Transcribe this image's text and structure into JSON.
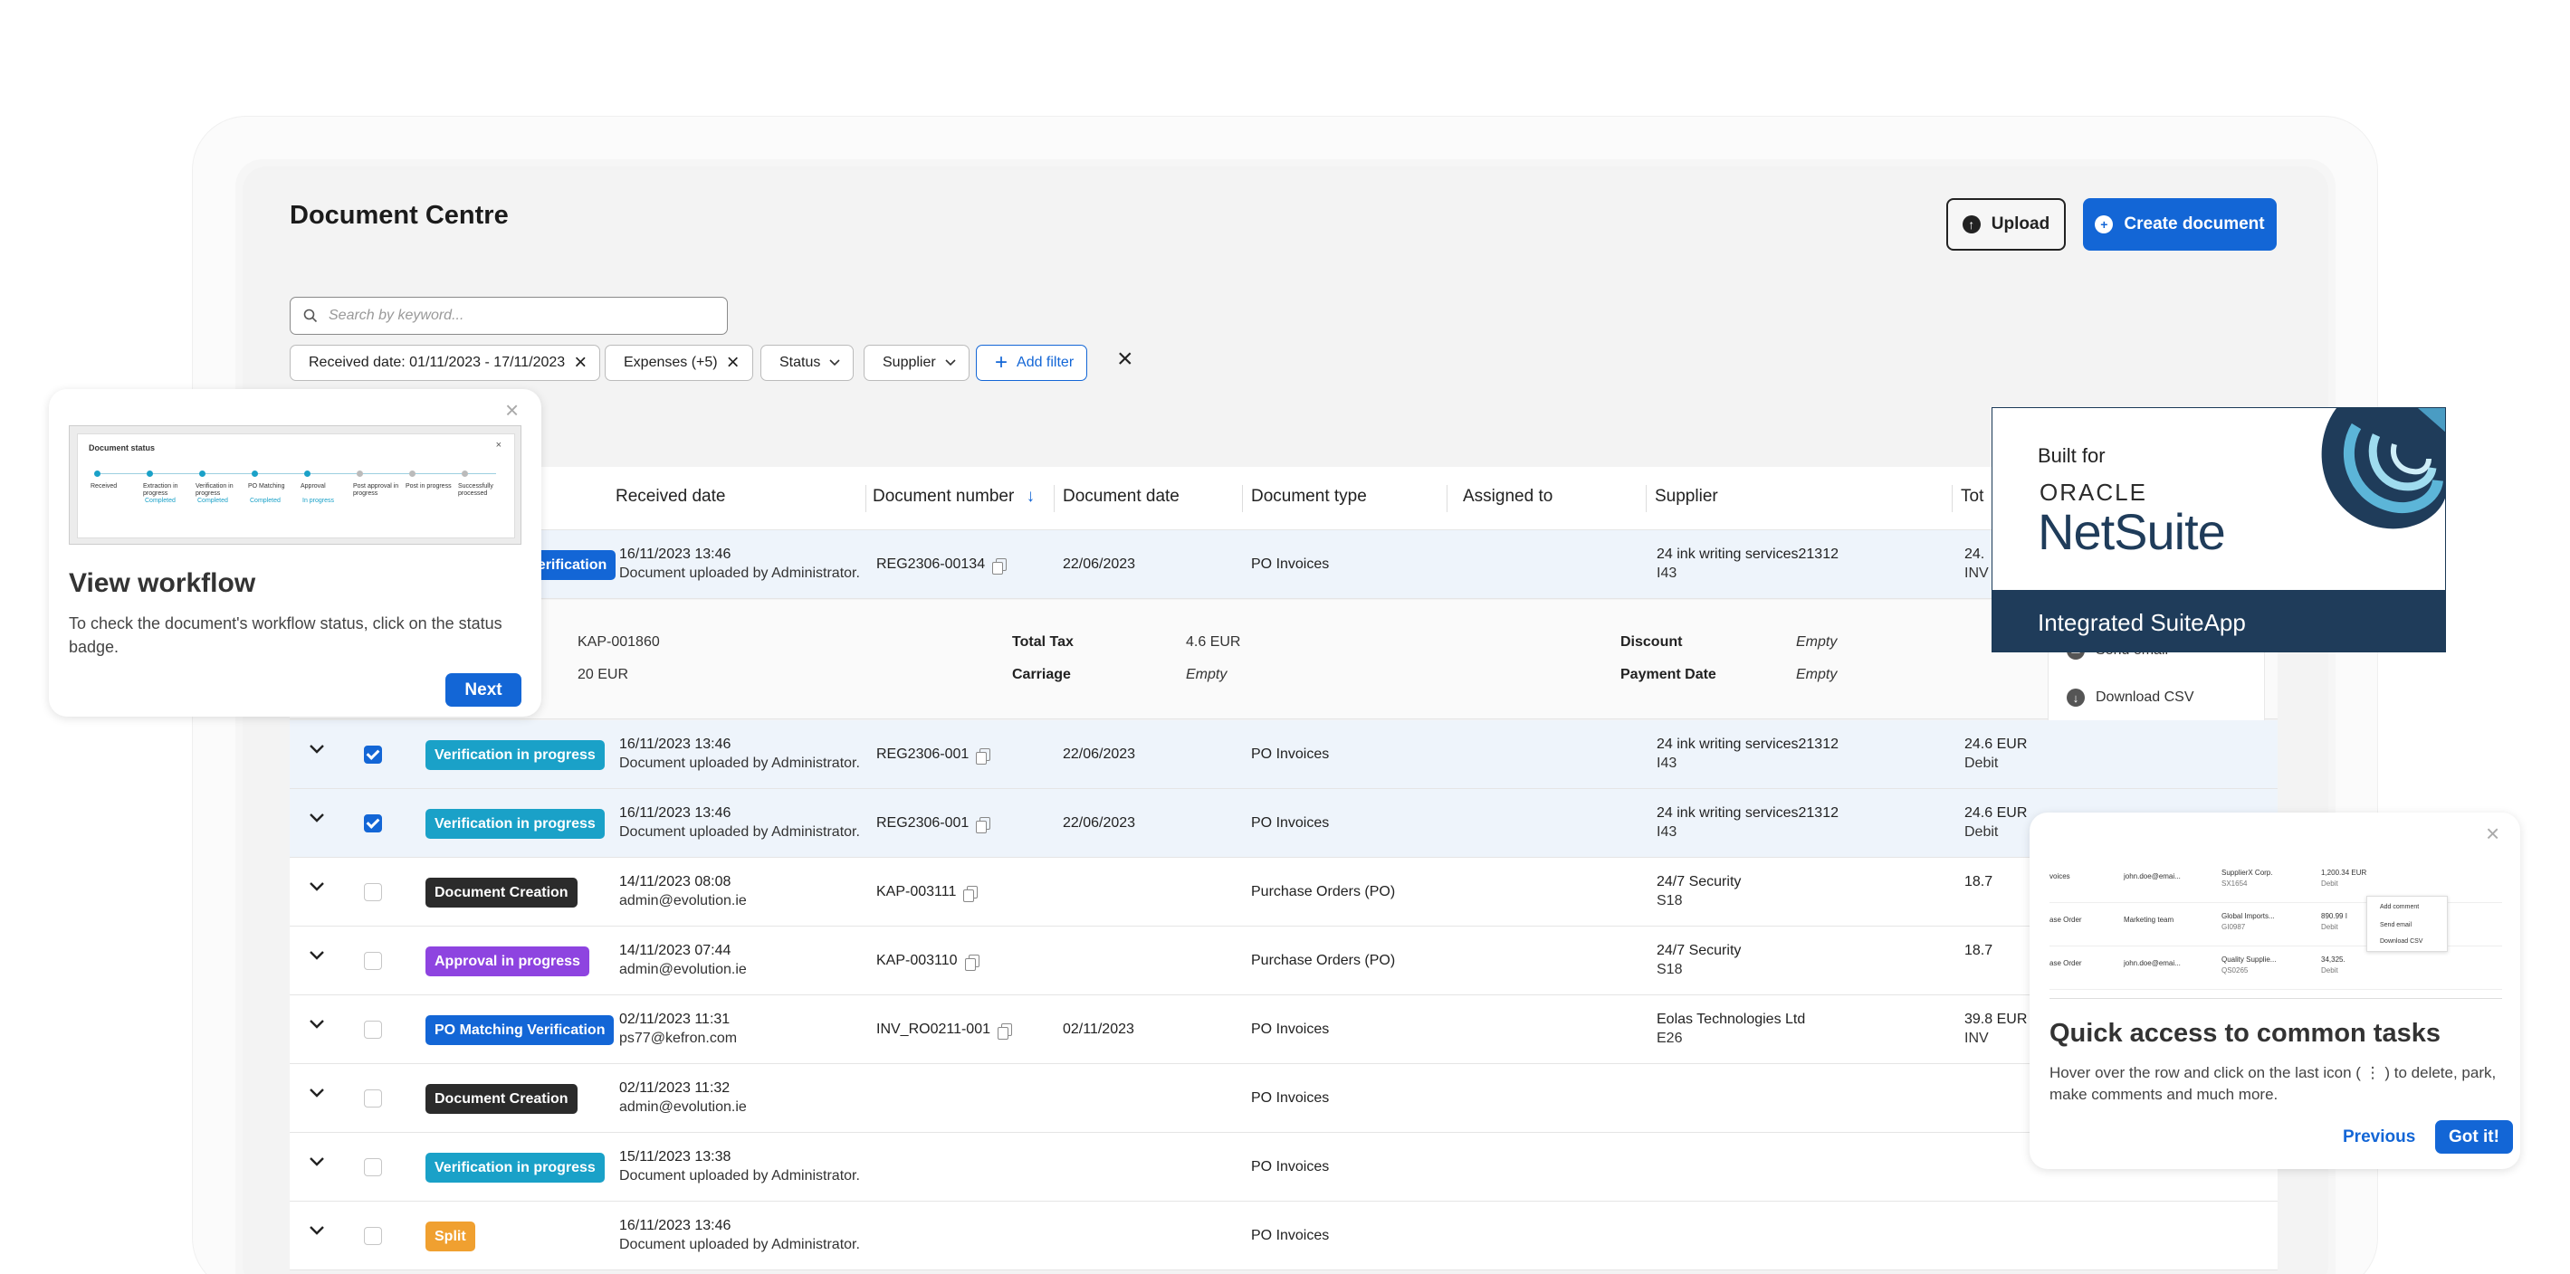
{
  "page": {
    "title": "Document Centre",
    "upload_label": "Upload",
    "create_label": "Create document"
  },
  "search": {
    "placeholder": "Search by keyword..."
  },
  "filters": {
    "received_date": "Received date: 01/11/2023 - 17/11/2023",
    "expenses": "Expenses (+5)",
    "status": "Status",
    "supplier": "Supplier",
    "add_filter": "Add filter"
  },
  "table": {
    "headers": {
      "received": "Received date",
      "docnum": "Document number",
      "docdate": "Document date",
      "doctype": "Document type",
      "assigned": "Assigned to",
      "supplier": "Supplier",
      "total": "Tot"
    },
    "rows": [
      {
        "badge": "Verification",
        "badge_color": "#1366d6",
        "date": "16/11/2023 13:46",
        "by": "Document uploaded by Administrator.",
        "docnum": "REG2306-00134",
        "docdate": "22/06/2023",
        "doctype": "PO Invoices",
        "supplier": "24 ink writing services21312",
        "supplier_code": "I43",
        "total": "24.",
        "total_sub": "INV",
        "checked": false
      },
      {
        "badge": "Verification in progress",
        "badge_color": "#1aa1c8",
        "date": "16/11/2023 13:46",
        "by": "Document uploaded by Administrator.",
        "docnum": "REG2306-001",
        "docdate": "22/06/2023",
        "doctype": "PO Invoices",
        "supplier": "24 ink writing services21312",
        "supplier_code": "I43",
        "total": "24.6 EUR",
        "total_sub": "Debit",
        "checked": true
      },
      {
        "badge": "Verification in progress",
        "badge_color": "#1aa1c8",
        "date": "16/11/2023 13:46",
        "by": "Document uploaded by Administrator.",
        "docnum": "REG2306-001",
        "docdate": "22/06/2023",
        "doctype": "PO Invoices",
        "supplier": "24 ink writing services21312",
        "supplier_code": "I43",
        "total": "24.6 EUR",
        "total_sub": "Debit",
        "checked": true
      },
      {
        "badge": "Document Creation",
        "badge_color": "#2b2b2b",
        "date": "14/11/2023 08:08",
        "by": "admin@evolution.ie",
        "docnum": "KAP-003111",
        "docdate": "",
        "doctype": "Purchase Orders (PO)",
        "supplier": "24/7 Security",
        "supplier_code": "S18",
        "total": "18.7",
        "total_sub": "",
        "checked": false
      },
      {
        "badge": "Approval in progress",
        "badge_color": "#8e44e0",
        "date": "14/11/2023 07:44",
        "by": "admin@evolution.ie",
        "docnum": "KAP-003110",
        "docdate": "",
        "doctype": "Purchase Orders (PO)",
        "supplier": "24/7 Security",
        "supplier_code": "S18",
        "total": "18.7",
        "total_sub": "",
        "checked": false
      },
      {
        "badge": "PO Matching Verification",
        "badge_color": "#1366d6",
        "date": "02/11/2023 11:31",
        "by": "ps77@kefron.com",
        "docnum": "INV_RO0211-001",
        "docdate": "02/11/2023",
        "doctype": "PO Invoices",
        "supplier": "Eolas Technologies Ltd",
        "supplier_code": "E26",
        "total": "39.8 EUR",
        "total_sub": "INV",
        "checked": false
      },
      {
        "badge": "Document Creation",
        "badge_color": "#2b2b2b",
        "date": "02/11/2023 11:32",
        "by": "admin@evolution.ie",
        "docnum": "",
        "docdate": "",
        "doctype": "PO Invoices",
        "supplier": "",
        "supplier_code": "",
        "total": "",
        "total_sub": "",
        "checked": false
      },
      {
        "badge": "Verification in progress",
        "badge_color": "#1aa1c8",
        "date": "15/11/2023 13:38",
        "by": "Document uploaded by Administrator.",
        "docnum": "",
        "docdate": "",
        "doctype": "PO Invoices",
        "supplier": "",
        "supplier_code": "",
        "total": "",
        "total_sub": "",
        "checked": false
      },
      {
        "badge": "Split",
        "badge_color": "#f0a030",
        "date": "16/11/2023 13:46",
        "by": "Document uploaded by Administrator.",
        "docnum": "",
        "docdate": "",
        "doctype": "PO Invoices",
        "supplier": "",
        "supplier_code": "",
        "total": "",
        "total_sub": "",
        "checked": false
      }
    ]
  },
  "expanded": {
    "ref": "KAP-001860",
    "amount": "20 EUR",
    "total_tax_label": "Total Tax",
    "total_tax_value": "4.6 EUR",
    "carriage_label": "Carriage",
    "carriage_value": "Empty",
    "discount_label": "Discount",
    "discount_value": "Empty",
    "payment_date_label": "Payment Date",
    "payment_date_value": "Empty"
  },
  "context_menu": {
    "send_email": "Send email",
    "download_csv": "Download CSV"
  },
  "tour_workflow": {
    "thumb_title": "Document status",
    "steps": [
      "Received",
      "Extraction in progress",
      "Verification in progress",
      "PO Matching",
      "Approval",
      "Post approval in progress",
      "Post in progress",
      "Successfully processed"
    ],
    "step_status": [
      "Completed",
      "Completed",
      "Completed",
      "In progress"
    ],
    "title": "View workflow",
    "body": "To check the document's workflow status, click on the status badge.",
    "next_label": "Next"
  },
  "netsuite": {
    "built_for": "Built for",
    "oracle": "ORACLE",
    "netsuite": "NetSuite",
    "integrated": "Integrated SuiteApp"
  },
  "tour_tasks": {
    "thumb_rows": [
      {
        "type": "voices",
        "assigned": "john.doe@emai...",
        "supplier": "SupplierX Corp.",
        "code": "SX1654",
        "amount": "1,200.34 EUR",
        "sub": "Debit"
      },
      {
        "type": "ase Order",
        "assigned": "Marketing team",
        "supplier": "Global Imports...",
        "code": "GI0987",
        "amount": "890.99 I",
        "sub": "Debit"
      },
      {
        "type": "ase Order",
        "assigned": "john.doe@emai...",
        "supplier": "Quality Supplie...",
        "code": "QS0265",
        "amount": "34,325.",
        "sub": "Debit"
      }
    ],
    "thumb_menu": [
      "Add comment",
      "Send email",
      "Download CSV"
    ],
    "title": "Quick access to common tasks",
    "body": "Hover over the row and click on the last icon ( ⋮ ) to delete, park, make comments and much more.",
    "previous_label": "Previous",
    "gotit_label": "Got it!"
  },
  "colors": {
    "primary": "#1366d6",
    "verification": "#1aa1c8",
    "approval": "#8e44e0",
    "creation": "#2b2b2b",
    "split": "#f0a030",
    "netsuite_navy": "#1f3c5a"
  }
}
